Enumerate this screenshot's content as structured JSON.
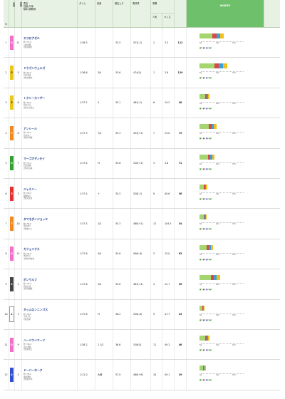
{
  "header": {
    "waku": "枠番",
    "umaban": "馬番",
    "horse": "馬名\n性齢/斤量\n騎手/調教師",
    "time": "タイム",
    "diff": "着差",
    "last3f": "推定上り",
    "weight": "馬体重",
    "odds_group": "単勝",
    "pop": "人気",
    "odds": "オッズ",
    "windex": "WINDEX",
    "sort": "▼"
  },
  "scale_ticks": [
    "50",
    "100",
    "150"
  ],
  "rows": [
    {
      "rank": "1",
      "waku": "8",
      "umaban": "11",
      "name": "エコロアゼル",
      "sex_age": "牝3 57.0",
      "jockey": "川田将雅",
      "trainer": "(栗)高柳大",
      "time": "1:36.5",
      "diff": "",
      "last3f": "33.5",
      "weight": "522(-2)",
      "pop": "2",
      "odds": "3.3",
      "index": "112",
      "mini": [
        "5",
        "2",
        "1",
        "1"
      ]
    },
    {
      "rank": "2",
      "waku": "5",
      "umaban": "5",
      "name": "ドラゴンウェルズ",
      "sex_age": "牡3 57.0",
      "jockey": "岩田望来",
      "trainer": "(栗)高橋亮",
      "time": "1:36.6",
      "diff": "3/4",
      "last3f": "33.6",
      "weight": "474(0)",
      "pop": "1",
      "odds": "2.8",
      "index": "129",
      "mini": [
        "6",
        "1",
        "3",
        "1"
      ]
    },
    {
      "rank": "3",
      "waku": "5",
      "umaban": "6",
      "name": "トクシーカイザー",
      "sex_age": "牡3 56.0",
      "jockey": "松山弘平",
      "trainer": "(栗)小島茂之",
      "time": "1:37.2",
      "diff": "4",
      "last3f": "35.1",
      "weight": "484(-2)",
      "pop": "6",
      "odds": "19.2",
      "index": "48",
      "mini": [
        "0",
        "0",
        "1",
        "0"
      ]
    },
    {
      "rank": "4",
      "waku": "7",
      "umaban": "8",
      "name": "アンシール",
      "sex_age": "牝3 56.0",
      "jockey": "北村友一",
      "trainer": "(栗)小崎憲",
      "time": "1:37.3",
      "diff": "7/4",
      "last3f": "35.3",
      "weight": "454(+2)",
      "pop": "7",
      "odds": "23.0",
      "index": "79",
      "mini": [
        "2",
        "1",
        "0",
        "1"
      ]
    },
    {
      "rank": "5",
      "waku": "6",
      "umaban": "7",
      "name": "マーゴオディセイ",
      "sex_age": "牡3 57.0",
      "jockey": "岩田康誠",
      "trainer": "(栗)杉山晴",
      "time": "1:37.4",
      "diff": "½",
      "last3f": "35.6",
      "weight": "510(+2)",
      "pop": "3",
      "odds": "3.8",
      "index": "71",
      "mini": [
        "2",
        "0",
        "0",
        "1"
      ]
    },
    {
      "rank": "6",
      "waku": "3",
      "umaban": "3",
      "name": "ジャスリー",
      "sex_age": "牡3 56.0",
      "jockey": "藤岡佑介",
      "trainer": "(栗)武英智",
      "time": "1:37.4",
      "diff": "+",
      "last3f": "35.5",
      "weight": "528(-2)",
      "pop": "8",
      "odds": "40.6",
      "index": "36",
      "mini": [
        "0",
        "0",
        "1",
        "0"
      ]
    },
    {
      "rank": "7",
      "waku": "7",
      "umaban": "10",
      "name": "タマモダイジョッキ",
      "sex_age": "牡3 56.0",
      "jockey": "国分恭介",
      "trainer": "(栗)藤川二",
      "time": "1:37.5",
      "diff": "1/2",
      "last3f": "35.3",
      "weight": "488(+2)",
      "pop": "12",
      "odds": "104.3",
      "index": "34",
      "mini": [
        "0",
        "0",
        "0",
        "1"
      ]
    },
    {
      "rank": "8",
      "waku": "8",
      "umaban": "12",
      "name": "カフェニクス",
      "sex_age": "牡3 56.0",
      "jockey": "吉田隼人",
      "trainer": "(栗)中竹和也",
      "time": "1:37.6",
      "diff": "3/4",
      "last3f": "35.6",
      "weight": "506(-6)",
      "pop": "5",
      "odds": "15.0",
      "index": "63",
      "mini": [
        "1",
        "0",
        "0",
        "1"
      ]
    },
    {
      "rank": "9",
      "waku": "2",
      "umaban": "2",
      "name": "ボンウルフ",
      "sex_age": "牡3 56.0",
      "jockey": "西村淳也",
      "trainer": "(栗)高橋義",
      "time": "1:37.8",
      "diff": "3/4",
      "last3f": "35.8",
      "weight": "484(+4)",
      "pop": "4",
      "odds": "12.7",
      "index": "96",
      "mini": [
        "1",
        "2",
        "1",
        "2"
      ]
    },
    {
      "rank": "10",
      "waku": "1",
      "umaban": "1",
      "name": "ネッムロンニンパス",
      "sex_age": "牡3 56.0",
      "jockey": "小沢大仁",
      "trainer": "(栗)谷潔",
      "time": "1:37.8",
      "diff": "½",
      "last3f": "36.2",
      "weight": "526(-6)",
      "pop": "9",
      "odds": "47.7",
      "index": "23",
      "mini": [
        "0",
        "0",
        "0",
        "1"
      ]
    },
    {
      "rank": "11",
      "waku": "8",
      "umaban": "9",
      "name": "ハードワイヤード",
      "sex_age": "牡3 56.0",
      "jockey": "古川奈穂",
      "trainer": "(栗)蛯名正",
      "time": "1:38.2",
      "diff": "2 1/2",
      "last3f": "36.6",
      "weight": "518(0)",
      "pop": "11",
      "odds": "49.2",
      "index": "46",
      "mini": [
        "0",
        "1",
        "0",
        "1"
      ]
    },
    {
      "rank": "12",
      "waku": "4",
      "umaban": "4",
      "name": "ドーバーホーク",
      "sex_age": "牡3 56.0",
      "jockey": "坂井瑠星",
      "trainer": "(栗)森大内",
      "time": "1:21.0",
      "diff": "大差",
      "last3f": "37.9",
      "weight": "488(+8)",
      "pop": "10",
      "odds": "49.1",
      "index": "29",
      "mini": [
        "0",
        "0",
        "0",
        "1"
      ]
    }
  ],
  "waku_colors": {
    "1": "#ffffff",
    "2": "#444444",
    "3": "#e23030",
    "4": "#3050d0",
    "5": "#e8c81a",
    "6": "#32a032",
    "7": "#f08a20",
    "8": "#f070c8"
  },
  "bar_colors": [
    "#a5d56f",
    "#d84a4a",
    "#3aa0d8",
    "#f0c020"
  ]
}
